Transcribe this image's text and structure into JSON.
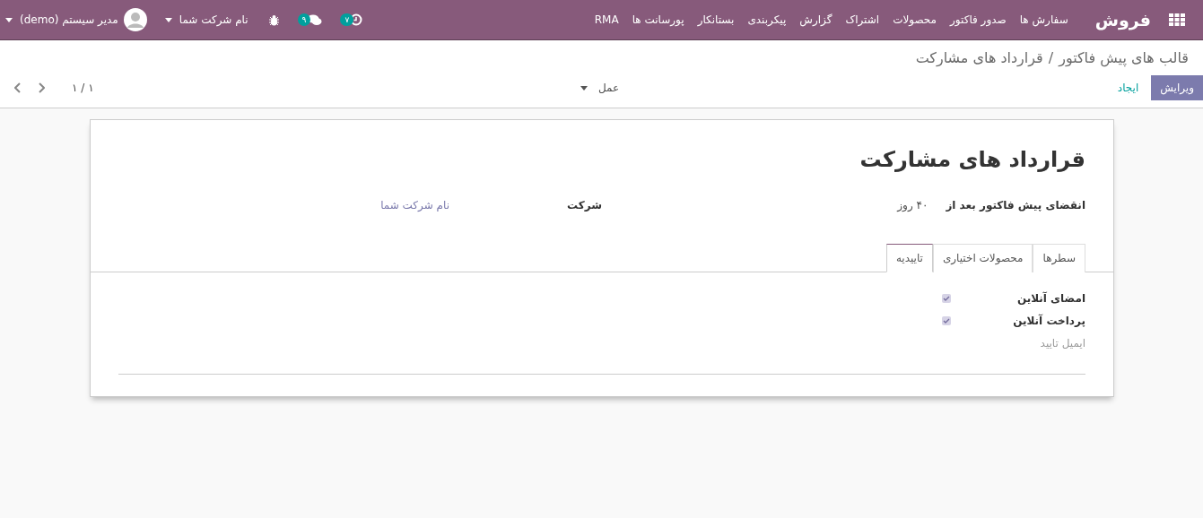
{
  "navbar": {
    "app_name": "فروش",
    "menu": [
      "سفارش ها",
      "صدور فاکتور",
      "محصولات",
      "اشتراک",
      "گزارش",
      "پیکربندی",
      "بستانکار",
      "پورسانت ها",
      "RMA"
    ],
    "activity_count": "۷",
    "message_count": "۹",
    "company": "نام شرکت شما",
    "user": "مدیر سیستم (demo)"
  },
  "breadcrumb": [
    "قالب های پیش فاکتور",
    "قرارداد های مشارکت"
  ],
  "breadcrumb_separator": "/",
  "buttons": {
    "edit": "ویرایش",
    "create": "ایجاد",
    "action": "عمل"
  },
  "pager": {
    "value": "۱ / ۱"
  },
  "record": {
    "title": "قرارداد های مشارکت",
    "fields": [
      {
        "label": "انقضای پیش فاکتور بعد از",
        "value": "۴۰",
        "unit": "روز",
        "kind": "number"
      },
      {
        "label": "شرکت",
        "value": "نام شرکت شما",
        "kind": "link"
      }
    ],
    "tabs": [
      {
        "label": "سطرها",
        "selected": false
      },
      {
        "label": "محصولات اختیاری",
        "selected": false
      },
      {
        "label": "تاییدیه",
        "selected": true
      }
    ],
    "tab_fields": [
      {
        "label": "امضای آنلاین",
        "kind": "checkbox",
        "checked": true
      },
      {
        "label": "پرداخت آنلاین",
        "kind": "checkbox",
        "checked": true
      },
      {
        "label": "ایمیل تایید",
        "kind": "empty"
      }
    ]
  }
}
